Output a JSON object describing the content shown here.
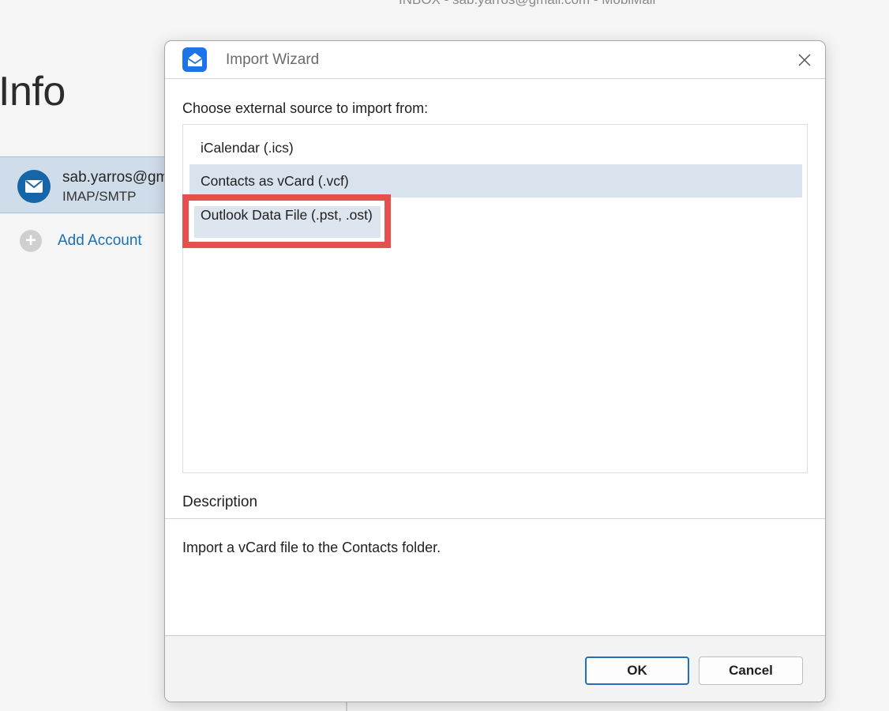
{
  "background": {
    "top_title": "INBOX - sab.yarros@gmail.com - MobiMail",
    "page_title": "Info",
    "account": {
      "email": "sab.yarros@gm",
      "type": "IMAP/SMTP",
      "icon": "envelope-icon"
    },
    "add_account_label": "Add Account"
  },
  "dialog": {
    "title": "Import Wizard",
    "app_icon": "mail-app-icon",
    "close_icon": "close-icon",
    "prompt": "Choose external source to import from:",
    "sources": [
      {
        "label": "iCalendar (.ics)",
        "selected": false
      },
      {
        "label": "Contacts as vCard (.vcf)",
        "selected": true
      },
      {
        "label": "Outlook Data File (.pst, .ost)",
        "selected": false
      }
    ],
    "description_heading": "Description",
    "description_text": "Import a vCard file to the Contacts folder.",
    "ok_label": "OK",
    "cancel_label": "Cancel"
  },
  "colors": {
    "accent": "#1e73e8",
    "selection": "#d9e3ee",
    "highlight": "#e5504d",
    "link": "#1a6fb3"
  }
}
